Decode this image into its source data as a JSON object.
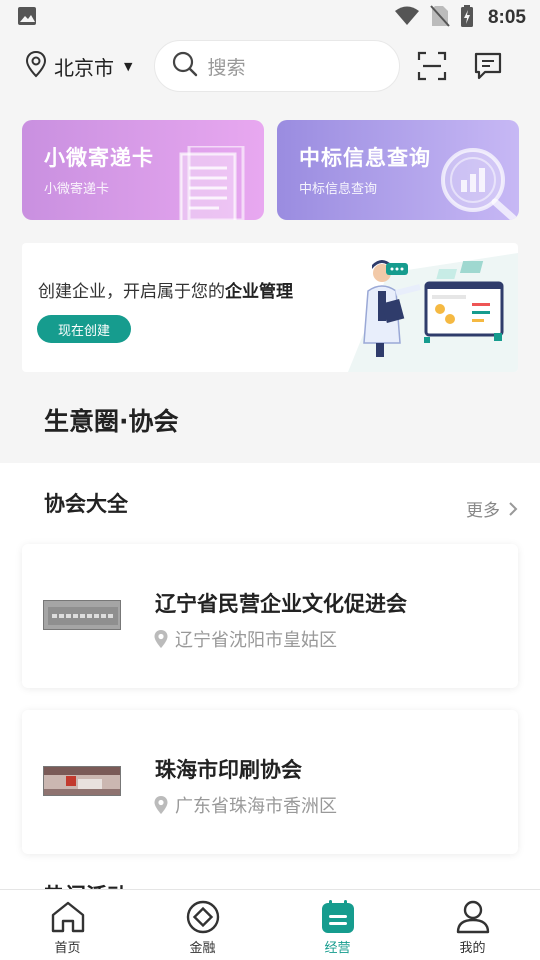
{
  "status_bar": {
    "time": "8:05"
  },
  "header": {
    "city": "北京市",
    "search_placeholder": "搜索"
  },
  "feature_cards": [
    {
      "title": "小微寄递卡",
      "subtitle": "小微寄递卡"
    },
    {
      "title": "中标信息查询",
      "subtitle": "中标信息查询"
    }
  ],
  "banner": {
    "text_prefix": "创建企业，开启属于您的",
    "text_bold": "企业管理",
    "button": "现在创建"
  },
  "section": {
    "title": "生意圈·协会"
  },
  "associations": {
    "title": "协会大全",
    "more": "更多",
    "items": [
      {
        "name": "辽宁省民营企业文化促进会",
        "location": "辽宁省沈阳市皇姑区"
      },
      {
        "name": "珠海市印刷协会",
        "location": "广东省珠海市香洲区"
      }
    ]
  },
  "next_section_partial": "热门活动",
  "bottom_nav": [
    {
      "label": "首页",
      "icon": "home-icon"
    },
    {
      "label": "金融",
      "icon": "finance-icon"
    },
    {
      "label": "经营",
      "icon": "business-icon",
      "active": true
    },
    {
      "label": "我的",
      "icon": "profile-icon"
    }
  ],
  "colors": {
    "accent": "#169c8e",
    "card_left": "#c990e0",
    "card_right": "#9a8ce0"
  }
}
